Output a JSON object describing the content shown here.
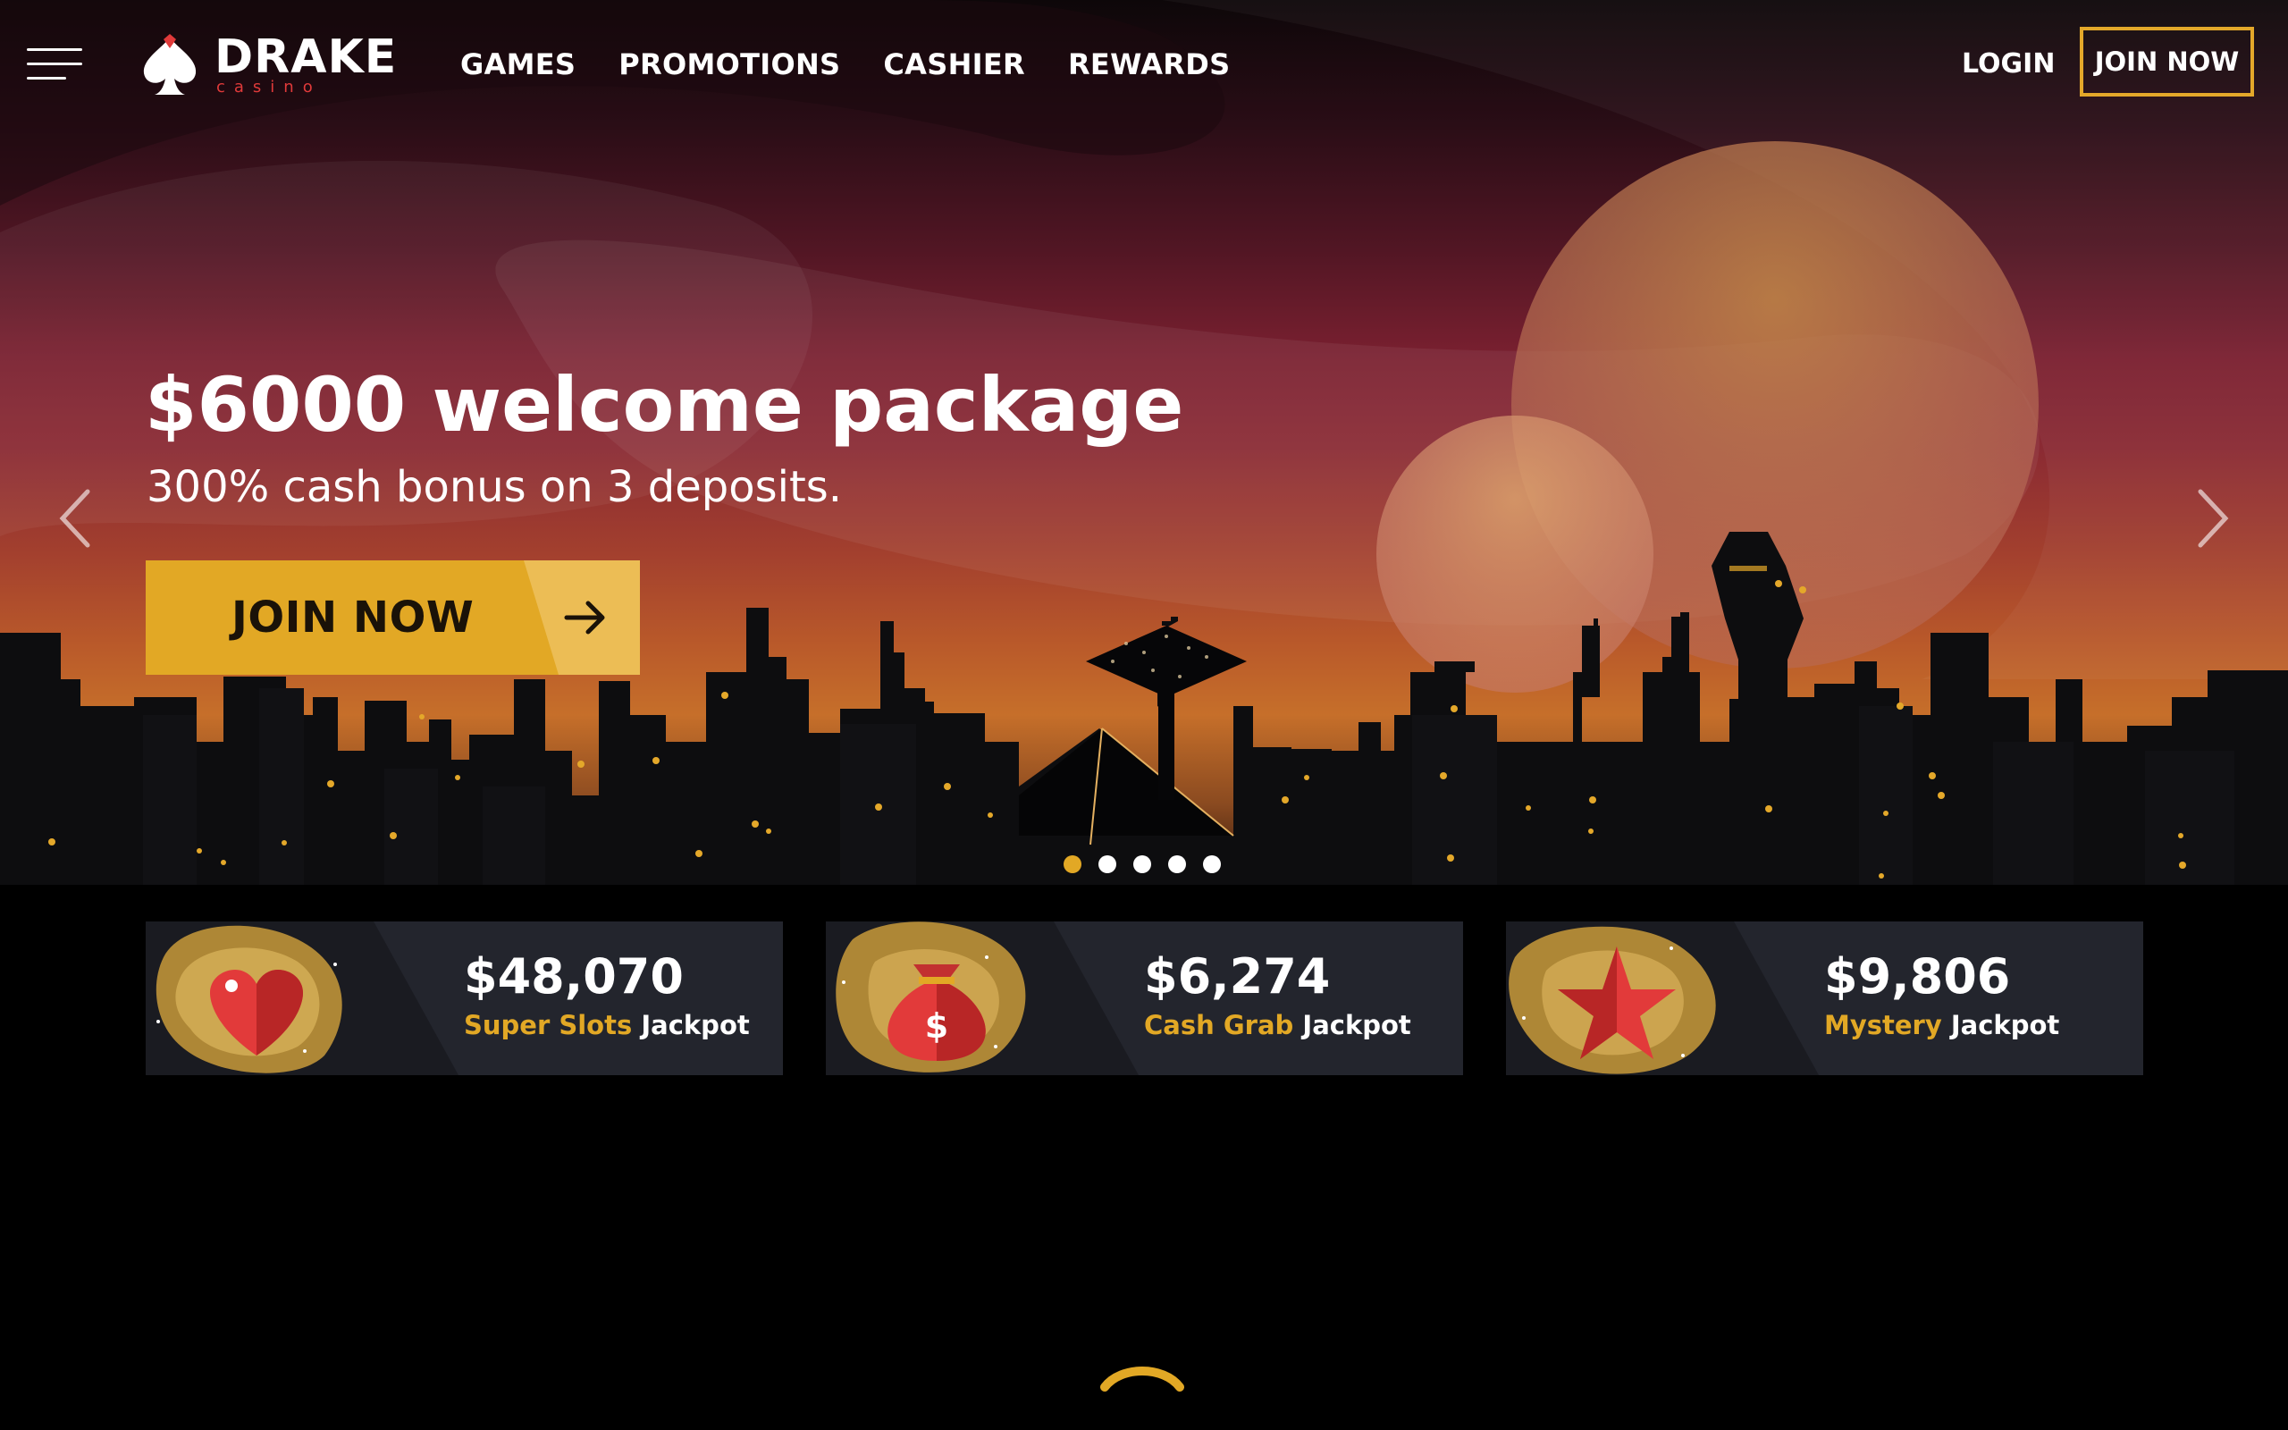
{
  "brand": {
    "name": "DRAKE",
    "sub": "casino",
    "accent": "#e03a3a"
  },
  "nav": {
    "items": [
      "GAMES",
      "PROMOTIONS",
      "CASHIER",
      "REWARDS"
    ],
    "login": "LOGIN",
    "join": "JOIN NOW"
  },
  "hero": {
    "headline": "$6000 welcome package",
    "subline": "300% cash bonus on 3 deposits.",
    "cta": "JOIN NOW",
    "slides": 5,
    "active_slide": 1
  },
  "jackpots": [
    {
      "amount": "$48,070",
      "highlight": "Super Slots",
      "suffix": "Jackpot",
      "icon": "heart-icon"
    },
    {
      "amount": "$6,274",
      "highlight": "Cash Grab",
      "suffix": "Jackpot",
      "icon": "money-bag-icon"
    },
    {
      "amount": "$9,806",
      "highlight": "Mystery",
      "suffix": "Jackpot",
      "icon": "star-icon"
    }
  ],
  "colors": {
    "gold": "#e2a825",
    "background": "#000000",
    "card": "#23252d"
  }
}
